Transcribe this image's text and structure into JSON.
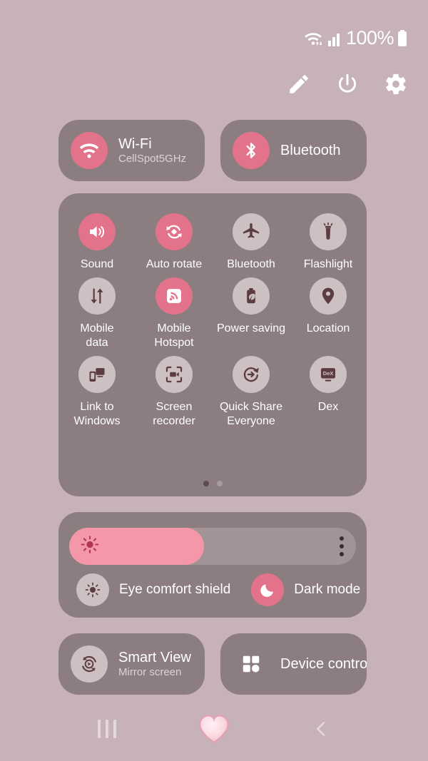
{
  "status_bar": {
    "wifi_icon": "wifi-data-icon",
    "signal_icon": "signal-bars-icon",
    "battery_percent": "100%",
    "battery_icon": "battery-full-icon"
  },
  "header": {
    "edit_icon": "pencil-icon",
    "power_icon": "power-icon",
    "settings_icon": "gear-icon"
  },
  "connectivity": [
    {
      "name": "wifi",
      "icon": "wifi-icon",
      "title": "Wi-Fi",
      "subtitle": "CellSpot5GHz",
      "active": true
    },
    {
      "name": "bluetooth",
      "icon": "bluetooth-icon",
      "title": "Bluetooth",
      "subtitle": "",
      "active": true
    }
  ],
  "quick_tiles": [
    {
      "name": "sound",
      "icon": "speaker-icon",
      "label": "Sound",
      "active": true
    },
    {
      "name": "auto-rotate",
      "icon": "auto-rotate-icon",
      "label": "Auto rotate",
      "active": true
    },
    {
      "name": "bluetooth",
      "icon": "airplane-icon",
      "label": "Bluetooth",
      "active": false
    },
    {
      "name": "flashlight",
      "icon": "flashlight-icon",
      "label": "Flashlight",
      "active": false
    },
    {
      "name": "mobile-data",
      "icon": "data-arrows-icon",
      "label": "Mobile\ndata",
      "active": false
    },
    {
      "name": "mobile-hotspot",
      "icon": "hotspot-icon",
      "label": "Mobile\nHotspot",
      "active": true
    },
    {
      "name": "power-saving",
      "icon": "battery-leaf-icon",
      "label": "Power saving",
      "active": false
    },
    {
      "name": "location",
      "icon": "location-pin-icon",
      "label": "Location",
      "active": false
    },
    {
      "name": "link-to-windows",
      "icon": "link-windows-icon",
      "label": "Link to\nWindows",
      "active": false
    },
    {
      "name": "screen-recorder",
      "icon": "screen-record-icon",
      "label": "Screen\nrecorder",
      "active": false
    },
    {
      "name": "quick-share",
      "icon": "quick-share-icon",
      "label": "Quick Share\nEveryone",
      "active": false
    },
    {
      "name": "dex",
      "icon": "dex-icon",
      "label": "Dex",
      "active": false
    }
  ],
  "pagination": {
    "total": 2,
    "current": 1
  },
  "brightness": {
    "icon": "brightness-sun-icon",
    "value_percent": 47,
    "menu_icon": "kebab-menu-icon"
  },
  "display_toggles": [
    {
      "name": "eye-comfort-shield",
      "icon": "eye-comfort-icon",
      "label": "Eye comfort shield",
      "active": false
    },
    {
      "name": "dark-mode",
      "icon": "moon-icon",
      "label": "Dark mode",
      "active": true
    }
  ],
  "bottom_tiles": [
    {
      "name": "smart-view",
      "icon": "smart-view-icon",
      "title": "Smart View",
      "subtitle": "Mirror screen",
      "active": false
    },
    {
      "name": "device-control",
      "icon": "device-control-icon",
      "title": "Device control",
      "subtitle": "",
      "active": false
    }
  ],
  "nav_bar": {
    "recents_icon": "recents-icon",
    "home_icon": "heart-home-icon",
    "back_icon": "back-chevron-icon"
  },
  "colors": {
    "background": "#c6b2b8",
    "panel": "#8c7d80",
    "accent_pink": "#e3738b",
    "slider_fill": "#f497a9",
    "inactive_circle": "#cdc0c2",
    "inactive_glyph": "#5c3c42",
    "text_primary": "#ffffff",
    "text_secondary": "#ddd3d5"
  }
}
